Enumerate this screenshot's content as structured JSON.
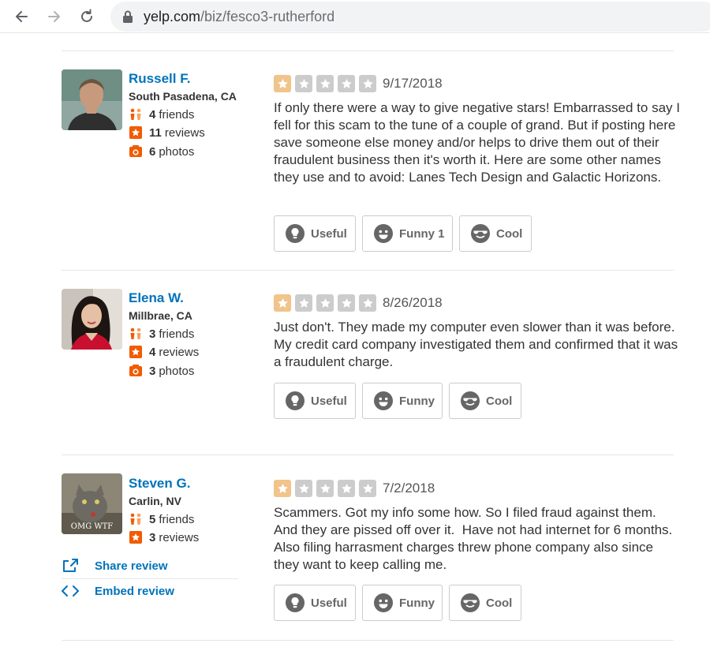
{
  "browser": {
    "url_domain": "yelp.com",
    "url_path": "/biz/fesco3-rutherford"
  },
  "reviews": [
    {
      "user": {
        "name": "Russell F.",
        "location": "South Pasadena, CA",
        "friends": "4",
        "friends_label": "friends",
        "reviews": "11",
        "reviews_label": "reviews",
        "photos": "6",
        "photos_label": "photos"
      },
      "rating": 1,
      "date": "9/17/2018",
      "text": "If only there were a way to give negative stars!  Embarrassed to say I fell for this scam to the tune of a couple of grand.  But if posting here save someone else money and/or helps to drive them out of their fraudulent business then it's worth it. Here are some other names they use and to avoid: Lanes Tech Design and Galactic Horizons.",
      "buttons": {
        "useful": "Useful",
        "funny": "Funny 1",
        "cool": "Cool"
      }
    },
    {
      "user": {
        "name": "Elena W.",
        "location": "Millbrae, CA",
        "friends": "3",
        "friends_label": "friends",
        "reviews": "4",
        "reviews_label": "reviews",
        "photos": "3",
        "photos_label": "photos"
      },
      "rating": 1,
      "date": "8/26/2018",
      "text": "Just don't. They made my computer even slower than it was before. My credit card company investigated them and confirmed that it was a fraudulent charge.",
      "buttons": {
        "useful": "Useful",
        "funny": "Funny",
        "cool": "Cool"
      }
    },
    {
      "user": {
        "name": "Steven G.",
        "location": "Carlin, NV",
        "friends": "5",
        "friends_label": "friends",
        "reviews": "3",
        "reviews_label": "reviews",
        "avatar_caption": "OMG WTF"
      },
      "rating": 1,
      "date": "7/2/2018",
      "text": "Scammers. Got my info some how. So I filed fraud against them.     And they are pissed off over it.  Have not had internet for 6 months. Also filing harrasment charges threw phone company also since they want to keep calling me.",
      "buttons": {
        "useful": "Useful",
        "funny": "Funny",
        "cool": "Cool"
      },
      "actions": {
        "share": "Share review",
        "embed": "Embed review"
      }
    }
  ],
  "colors": {
    "link": "#0073bb",
    "star_on": "#f0c48a",
    "star_off": "#cccccc",
    "stat_icon": "#f15c00"
  },
  "icons": [
    "back-arrow-icon",
    "forward-arrow-icon",
    "reload-icon",
    "lock-icon",
    "friends-icon",
    "review-star-icon",
    "camera-icon",
    "lightbulb-icon",
    "funny-face-icon",
    "cool-face-icon",
    "share-icon",
    "embed-icon"
  ]
}
